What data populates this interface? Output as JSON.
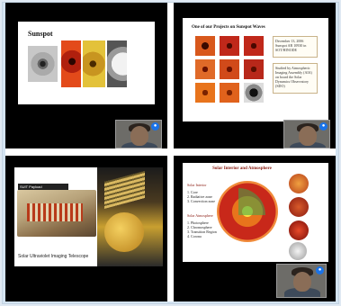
{
  "tiles": [
    {
      "slide_title": "Sunspot"
    },
    {
      "slide_title": "One of our Projects on Sunspot Waves",
      "info_box_1": "December 13, 2006 Sunspot AR 10930 in SOT/HINODE",
      "info_box_2": "Studied by Atmospheric Imaging Assembly (AIA) on board the Solar Dynamics Observatory (SDO)"
    },
    {
      "slide_tag": "SUIT Payload",
      "caption": "Solar Ultraviolet Imaging Telescope"
    },
    {
      "slide_title": "Solar Interior and Atmosphere",
      "interior_heading": "Solar Interior",
      "interior_items": [
        "1. Core",
        "2. Radiative zone",
        "3. Convection zone"
      ],
      "atmosphere_heading": "Solar Atmosphere",
      "atmosphere_items": [
        "1. Photosphere",
        "2. Chromosphere",
        "3. Transition Region",
        "4. Corona"
      ]
    }
  ],
  "colors": {
    "accent": "#1a73e8",
    "sun_red": "#c8281a",
    "sun_orange": "#e8741c",
    "sun_yellow": "#e3c23a"
  }
}
